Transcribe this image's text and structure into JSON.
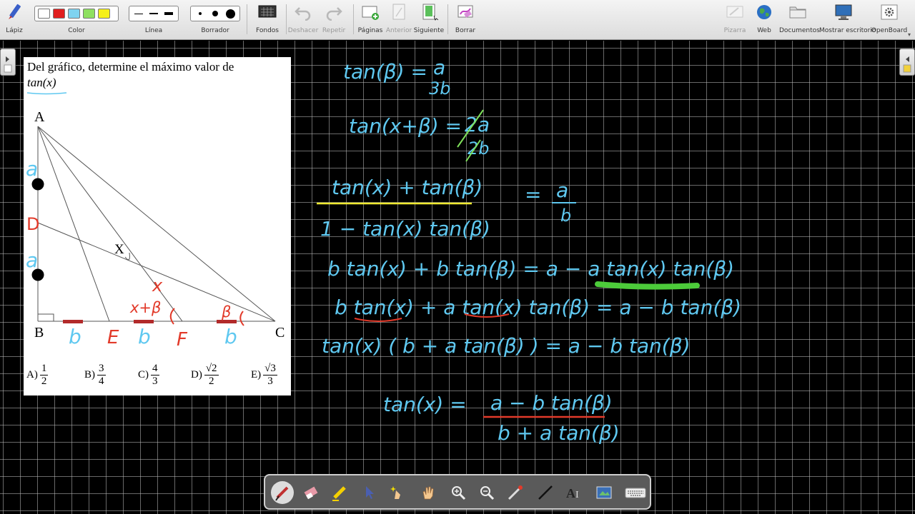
{
  "toolbar": {
    "pen": "Lápiz",
    "color": "Color",
    "line": "Línea",
    "eraser": "Borrador",
    "backgrounds": "Fondos",
    "undo": "Deshacer",
    "redo": "Repetir",
    "pages": "Páginas",
    "previous": "Anterior",
    "next": "Siguiente",
    "clear": "Borrar",
    "board": "Pizarra",
    "web": "Web",
    "documents": "Documentos",
    "show_desktop": "Mostrar escritorio",
    "openboard": "OpenBoard",
    "colors": [
      "#ffffff",
      "#e01f1f",
      "#7fd3f0",
      "#8fe060",
      "#f5f01a"
    ]
  },
  "problem": {
    "statement": "Del gráfico, determine el máximo valor de",
    "expression": "tan(x)",
    "labels": {
      "A": "A",
      "B": "B",
      "C": "C",
      "D": "D",
      "E": "E",
      "F": "F",
      "X": "X"
    },
    "options": [
      {
        "letter": "A)",
        "num": "1",
        "den": "2"
      },
      {
        "letter": "B)",
        "num": "3",
        "den": "4"
      },
      {
        "letter": "C)",
        "num": "4",
        "den": "3"
      },
      {
        "letter": "D)",
        "num": "√2",
        "den": "2"
      },
      {
        "letter": "E)",
        "num": "√3",
        "den": "3"
      }
    ]
  },
  "annotations": {
    "a1": "a",
    "a2": "a",
    "x_angle": "x",
    "x_plus_beta": "x+β",
    "beta": "β",
    "b1": "b",
    "b2": "b",
    "b3": "b",
    "E": "E",
    "F": "F",
    "D": "D"
  },
  "work": {
    "l1_lhs": "tan(β) =",
    "l1_num": "a",
    "l1_den": "3b",
    "l2_lhs": "tan(x+β) =",
    "l2_num": "2a",
    "l2_den": "2b",
    "l3_num": "tan(x) + tan(β)",
    "l3_den": "1 − tan(x) tan(β)",
    "l3_rhs_num": "a",
    "l3_rhs_den": "b",
    "l4": "b tan(x) + b tan(β) = a − a tan(x) tan(β)",
    "l5": "b tan(x) + a tan(x) tan(β) = a − b tan(β)",
    "l6": "tan(x) ( b + a tan(β) ) = a − b tan(β)",
    "l7_lhs": "tan(x) =",
    "l7_num": "a − b tan(β)",
    "l7_den": "b + a tan(β)"
  }
}
